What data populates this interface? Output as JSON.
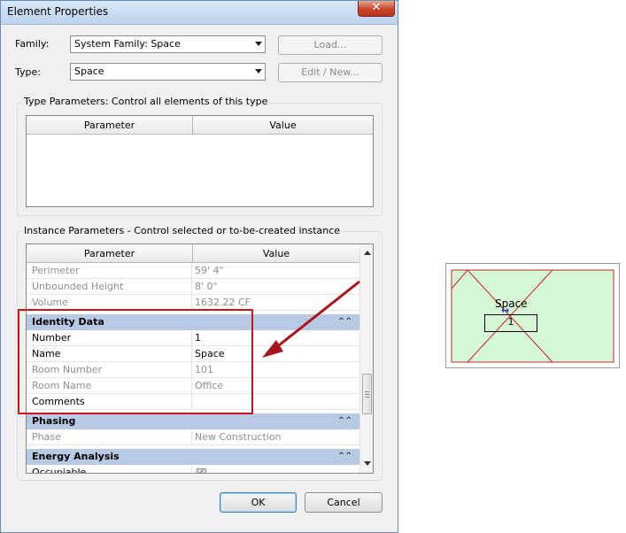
{
  "window": {
    "title": "Element Properties",
    "close_glyph": "✕"
  },
  "family": {
    "label": "Family:",
    "value": "System Family: Space",
    "load_button": "Load..."
  },
  "type": {
    "label": "Type:",
    "value": "Space",
    "edit_button": "Edit / New..."
  },
  "type_parameters": {
    "group_label": "Type Parameters: Control all elements of this type",
    "columns": [
      "Parameter",
      "Value"
    ]
  },
  "instance_parameters": {
    "group_label": "Instance Parameters - Control selected or to-be-created instance",
    "columns": [
      "Parameter",
      "Value"
    ],
    "rows_top": [
      {
        "param": "Perimeter",
        "value": "59'  4\"",
        "greyed": true
      },
      {
        "param": "Unbounded Height",
        "value": "8'  0\"",
        "greyed": true
      },
      {
        "param": "Volume",
        "value": "1632.22 CF",
        "greyed": true
      }
    ],
    "sections": [
      {
        "name": "Identity Data",
        "collapse_glyph": "⌃",
        "rows": [
          {
            "param": "Number",
            "value": "1",
            "greyed": false
          },
          {
            "param": "Name",
            "value": "Space",
            "greyed": false
          },
          {
            "param": "Room Number",
            "value": "101",
            "greyed": true
          },
          {
            "param": "Room Name",
            "value": "Office",
            "greyed": true
          },
          {
            "param": "Comments",
            "value": "",
            "greyed": false
          }
        ]
      },
      {
        "name": "Phasing",
        "collapse_glyph": "⌃",
        "rows": [
          {
            "param": "Phase",
            "value": "New Construction",
            "greyed": true
          }
        ]
      },
      {
        "name": "Energy Analysis",
        "collapse_glyph": "⌃",
        "rows": [
          {
            "param": "Occupiable",
            "value": "",
            "greyed": false
          }
        ]
      }
    ]
  },
  "buttons": {
    "ok": "OK",
    "cancel": "Cancel"
  },
  "preview": {
    "space_label": "Space",
    "number_tag": "1"
  },
  "colors": {
    "highlight_box": "#c8161d",
    "arrow": "#a8141b",
    "space_fill": "#d6f7d6",
    "section_header": "#b8c9e3"
  },
  "icons": {
    "close": "close-icon",
    "dropdown": "chevron-down-icon",
    "collapse": "chevron-up-icon",
    "annotation_arrow": "arrow-icon"
  }
}
